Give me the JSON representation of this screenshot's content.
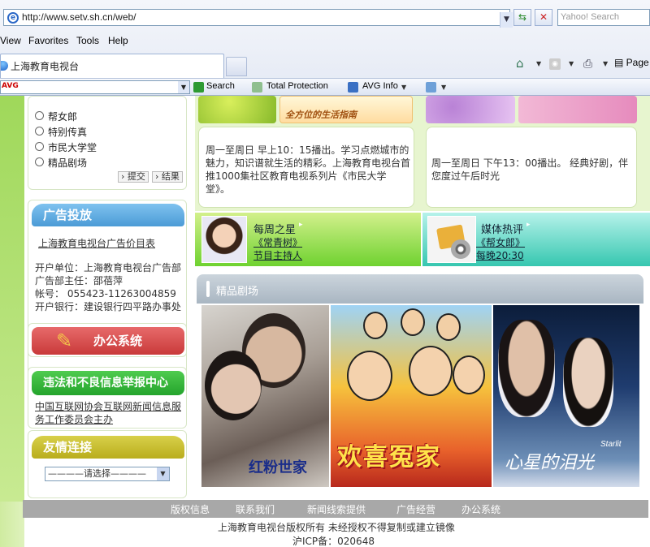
{
  "browser": {
    "url": "http://www.setv.sh.cn/web/",
    "search_placeholder": "Yahoo! Search",
    "menu": [
      "View",
      "Favorites",
      "Tools",
      "Help"
    ],
    "tab_title": "上海教育电视台",
    "page_label": "Page",
    "avg_toolbar": {
      "search_label": "Search",
      "total_protection_label": "Total Protection",
      "avg_info_label": "AVG Info"
    }
  },
  "poll": {
    "options": [
      "帮女郎",
      "特别传真",
      "市民大学堂",
      "精品剧场"
    ],
    "submit_label": "提交",
    "results_label": "结果"
  },
  "ad_box": {
    "title": "广告投放",
    "link": "上海教育电视台广告价目表",
    "lines": [
      "开户单位：上海教育电视台广告部",
      "广告部主任：邵蓓萍",
      "帐号： 055423-11263004859",
      "开户银行：建设银行四平路办事处"
    ]
  },
  "office": {
    "title": "办公系统"
  },
  "report": {
    "title": "违法和不良信息举报中心",
    "text": "中国互联网协会互联网新闻信息服务工作委员会主办"
  },
  "links": {
    "title": "友情连接",
    "select_value": "————请选择————"
  },
  "featured": {
    "left_card_heading": "全方位的生活指南",
    "left_text": "周一至周日 早上10：15播出。学习点燃城市的魅力，知识谱就生活的精彩。上海教育电视台首推1000集社区教育电视系列片《市民大学堂》。",
    "right_text": "周一至周日 下午13：00播出。 经典好剧，伴您度过午后时光"
  },
  "star": {
    "title": "每周之星",
    "link1": "《常青树》",
    "link2": "节目主持人"
  },
  "media": {
    "title": "媒体热评",
    "link1": "《帮女郎》",
    "link2": "每晚20:30"
  },
  "drama": {
    "title": "精品剧场",
    "posters": [
      {
        "title": "红粉世家"
      },
      {
        "title": "欢喜冤家"
      },
      {
        "title": "心星的泪光",
        "subtitle": "Starlit"
      }
    ]
  },
  "footer": {
    "links": [
      "版权信息",
      "联系我们",
      "新闻线索提供",
      "广告经营",
      "办公系统"
    ],
    "copyright": "上海教育电视台版权所有   未经授权不得复制或建立镜像",
    "icp": "沪ICP备：020648"
  },
  "colors": {
    "ad_head": "#4b9bd6",
    "office_head": "#c93a3a",
    "report_head": "#24a42c",
    "links_head": "#b9ad1c",
    "footer_bar": "#a8a8a8"
  }
}
